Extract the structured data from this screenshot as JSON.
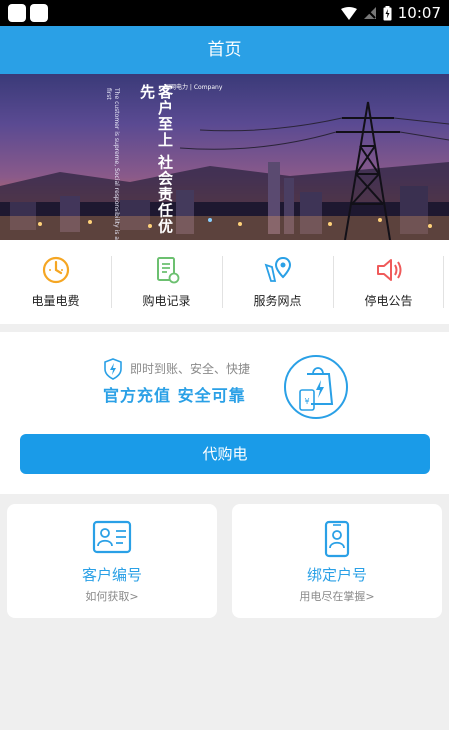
{
  "status_bar": {
    "time": "10:07"
  },
  "header": {
    "title": "首页"
  },
  "banner": {
    "slogan": "客户至上 社会责任优先",
    "slogan_en": "The customer is supreme, Social responsibility is a first",
    "logo_text": "国网电力 | Company"
  },
  "quick_nav": [
    {
      "label": "电量电费",
      "icon": "meter-icon"
    },
    {
      "label": "购电记录",
      "icon": "receipt-icon"
    },
    {
      "label": "服务网点",
      "icon": "location-icon"
    },
    {
      "label": "停电公告",
      "icon": "speaker-icon"
    }
  ],
  "recharge": {
    "subtitle": "即时到账、安全、快捷",
    "headline": "官方充值  安全可靠",
    "button_label": "代购电"
  },
  "cards": [
    {
      "title": "客户编号",
      "subtitle": "如何获取>",
      "icon": "id-card-icon"
    },
    {
      "title": "绑定户号",
      "subtitle": "用电尽在掌握>",
      "icon": "phone-user-icon"
    }
  ],
  "colors": {
    "accent": "#2aa0e6",
    "button": "#1a9be8",
    "orange": "#f5a623",
    "green": "#6cc070",
    "red": "#ef5a5a"
  }
}
